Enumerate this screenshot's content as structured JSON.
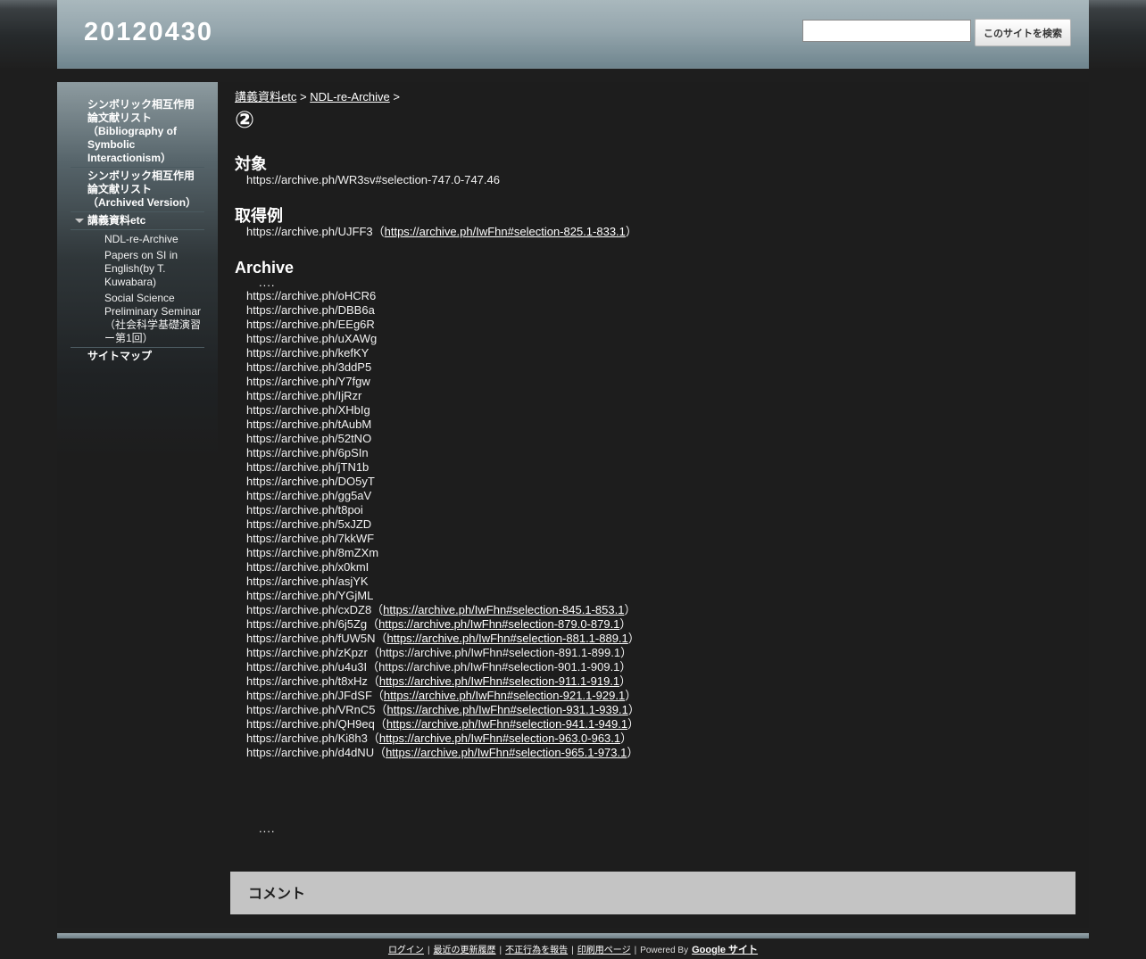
{
  "header": {
    "site_title": "20120430",
    "search_button": "このサイトを検索",
    "search_value": ""
  },
  "sidebar": {
    "items": [
      {
        "label": "シンボリック相互作用論文献リスト（Bibliography of Symbolic Interactionism）"
      },
      {
        "label": "シンボリック相互作用論文献リスト（Archived Version）"
      },
      {
        "label": "講義資料etc"
      },
      {
        "label": "NDL-re-Archive"
      },
      {
        "label": "Papers on SI in English(by T. Kuwabara)"
      },
      {
        "label": "Social Science Preliminary Seminar（社会科学基礎演習ー第1回）"
      },
      {
        "label": "サイトマップ"
      }
    ]
  },
  "breadcrumb": {
    "crumb1": "講義資料etc",
    "crumb2": "NDL-re-Archive",
    "sep": ">"
  },
  "page": {
    "title": "②",
    "target_heading": "対象",
    "target_line": "https://archive.ph/WR3sv#selection-747.0-747.46",
    "example_heading": "取得例",
    "example_text": "https://archive.ph/UJFF3（",
    "example_link": "https://archive.ph/IwFhn#selection-825.1-833.1",
    "example_close": "）",
    "archive_heading": "Archive",
    "dots": "....",
    "dots_bottom": "....",
    "archive_plain": [
      "https://archive.ph/oHCR6",
      "https://archive.ph/DBB6a",
      "https://archive.ph/EEg6R",
      "https://archive.ph/uXAWg",
      "https://archive.ph/kefKY",
      "https://archive.ph/3ddP5",
      "https://archive.ph/Y7fgw",
      "https://archive.ph/IjRzr",
      "https://archive.ph/XHbIg",
      "https://archive.ph/tAubM",
      "https://archive.ph/52tNO",
      "https://archive.ph/6pSIn",
      "https://archive.ph/jTN1b",
      "https://archive.ph/DO5yT",
      "https://archive.ph/gg5aV",
      "https://archive.ph/t8poi",
      "https://archive.ph/5xJZD",
      "https://archive.ph/7kkWF",
      "https://archive.ph/8mZXm",
      "https://archive.ph/x0kmI",
      "https://archive.ph/asjYK",
      "https://archive.ph/YGjML"
    ],
    "archive_linked": [
      {
        "text": "https://archive.ph/cxDZ8（",
        "link": "https://archive.ph/IwFhn#selection-845.1-853.1",
        "close": "）"
      },
      {
        "text": "https://archive.ph/6j5Zg（",
        "link": "https://archive.ph/IwFhn#selection-879.0-879.1",
        "close": "）"
      },
      {
        "text": "https://archive.ph/fUW5N（",
        "link": "https://archive.ph/IwFhn#selection-881.1-889.1",
        "close": "）"
      },
      {
        "text": "https://archive.ph/zKpzr（https://archive.ph/IwFhn#selection-891.1-899.1）",
        "link": "",
        "close": ""
      },
      {
        "text": "https://archive.ph/u4u3I（https://archive.ph/IwFhn#selection-901.1-909.1）",
        "link": "",
        "close": ""
      },
      {
        "text": "https://archive.ph/t8xHz（",
        "link": "https://archive.ph/IwFhn#selection-911.1-919.1",
        "close": "）"
      },
      {
        "text": "https://archive.ph/JFdSF（",
        "link": "https://archive.ph/IwFhn#selection-921.1-929.1",
        "close": "）"
      },
      {
        "text": "https://archive.ph/VRnC5（",
        "link": "https://archive.ph/IwFhn#selection-931.1-939.1",
        "close": "）"
      },
      {
        "text": "https://archive.ph/QH9eq（",
        "link": "https://archive.ph/IwFhn#selection-941.1-949.1",
        "close": "）"
      },
      {
        "text": "https://archive.ph/Ki8h3（",
        "link": "https://archive.ph/IwFhn#selection-963.0-963.1",
        "close": "）"
      },
      {
        "text": "https://archive.ph/d4dNU（",
        "link": "https://archive.ph/IwFhn#selection-965.1-973.1",
        "close": "）"
      }
    ]
  },
  "comments": {
    "heading": "コメント"
  },
  "footer": {
    "login": "ログイン",
    "recent": "最近の更新履歴",
    "report": "不正行為を報告",
    "print": "印刷用ページ",
    "powered": "Powered By",
    "google_sites": "Google サイト",
    "sep": "|"
  }
}
